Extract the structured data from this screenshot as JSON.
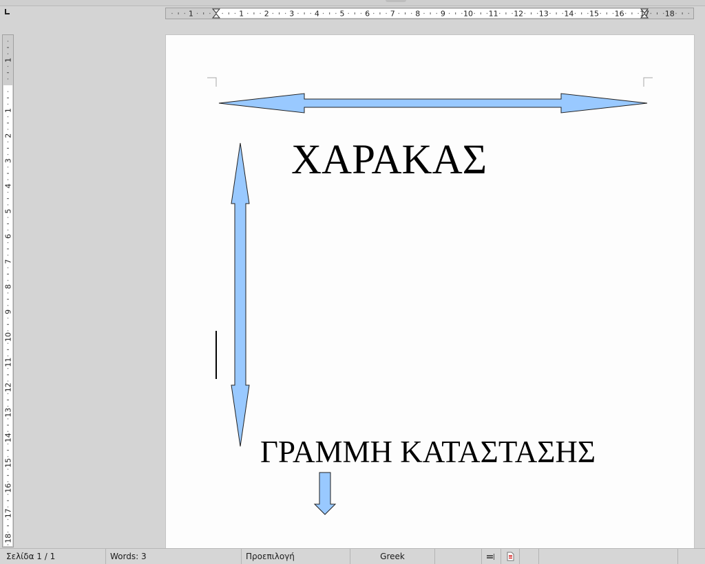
{
  "rulers": {
    "horizontal": {
      "labels": [
        "1",
        "1",
        "2",
        "3",
        "4",
        "5",
        "6",
        "7",
        "8",
        "9",
        "10",
        "11",
        "12",
        "13",
        "14",
        "15",
        "16",
        "17",
        "18"
      ]
    },
    "vertical": {
      "labels": [
        "1",
        "1",
        "2",
        "3",
        "4",
        "5",
        "6",
        "7",
        "8",
        "9",
        "10",
        "11",
        "12",
        "13",
        "14",
        "15",
        "16",
        "17",
        "18"
      ]
    }
  },
  "document": {
    "heading": "ΧΑΡΑΚΑΣ",
    "subheading": "ΓΡΑΜΜΗ ΚΑΤΑΣΤΑΣΗΣ",
    "shape_fill": "#99c9ff",
    "shape_stroke": "#1f1f1f"
  },
  "status_bar": {
    "page": "Σελίδα 1 / 1",
    "words": "Words: 3",
    "page_style": "Προεπιλογή",
    "language": "Greek"
  }
}
